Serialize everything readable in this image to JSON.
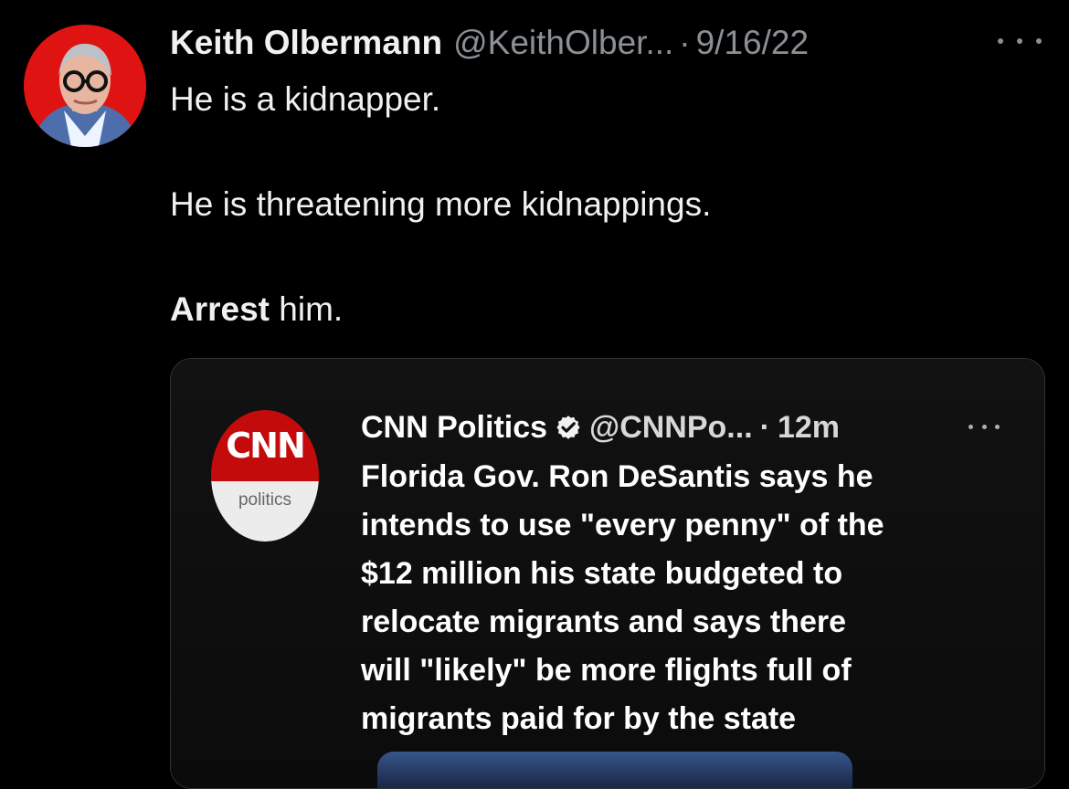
{
  "tweet": {
    "author_name": "Keith Olbermann",
    "author_handle": "@KeithOlber...",
    "separator": "·",
    "date": "9/16/22",
    "lines": [
      {
        "text": "He is a kidnapper."
      },
      {
        "text": "He is threatening more kidnappings."
      },
      {
        "bold": "Arrest",
        "rest": " him."
      }
    ]
  },
  "quoted_tweet": {
    "author_name": "CNN Politics",
    "author_handle": "@CNNPo...",
    "separator": "·",
    "time": "12m",
    "logo_top": "CNN",
    "logo_bottom": "politics",
    "body_lines": [
      "Florida Gov. Ron DeSantis says he",
      "intends to use \"every penny\" of the",
      "$12 million his state budgeted to",
      "relocate migrants and says there",
      "will \"likely\" be more flights full of",
      "migrants paid for by the state"
    ]
  },
  "icons": {
    "avatar": "avatar-icon",
    "more": "more-icon",
    "verified": "verified-badge-icon",
    "quote_more": "more-icon"
  },
  "colors": {
    "background": "#000000",
    "avatar_background": "#e01313",
    "cnn_red": "#c40b0b",
    "muted": "#8b9096"
  }
}
